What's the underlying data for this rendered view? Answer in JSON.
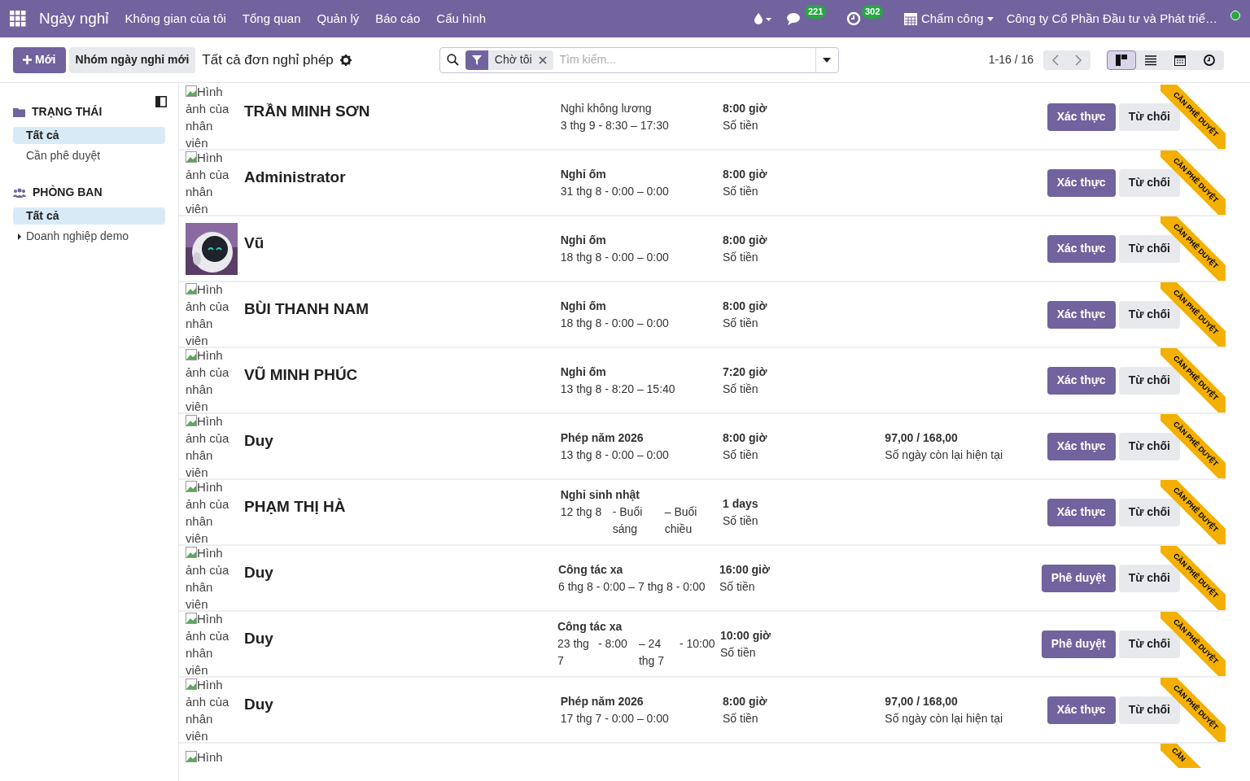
{
  "navbar": {
    "app_name": "Ngày nghỉ",
    "menu": [
      "Không gian của tôi",
      "Tổng quan",
      "Quản lý",
      "Báo cáo",
      "Cấu hình"
    ],
    "message_count": "221",
    "activity_count": "302",
    "attendance": "Chấm công",
    "company": "Công ty Cổ Phần Đầu tư và Phát triể…"
  },
  "control_panel": {
    "new_button": "Mới",
    "group_button": "Nhóm ngày nghỉ mới",
    "title": "Tất cả đơn nghỉ phép",
    "search": {
      "facet": "Chờ tôi",
      "placeholder": "Tìm kiếm..."
    },
    "pager": "1-16 / 16",
    "views": [
      {
        "kind": "kanban",
        "selected": true
      },
      {
        "kind": "list",
        "selected": false
      },
      {
        "kind": "calendar",
        "selected": false
      },
      {
        "kind": "activity",
        "selected": false
      }
    ]
  },
  "sidebar": {
    "sections": [
      {
        "kind": "status",
        "title": "TRẠNG THÁI",
        "items": [
          {
            "label": "Tất cả",
            "selected": true,
            "expandable": false
          },
          {
            "label": "Cần phê duyệt",
            "selected": false,
            "expandable": false
          }
        ]
      },
      {
        "kind": "department",
        "title": "PHÒNG BAN",
        "items": [
          {
            "label": "Tất cả",
            "selected": true,
            "expandable": false
          },
          {
            "label": "Doanh nghiệp demo",
            "selected": false,
            "expandable": true
          }
        ]
      }
    ]
  },
  "cards": [
    {
      "image": {
        "kind": "broken",
        "alt": "Hình ảnh của nhân viên"
      },
      "name": "TRẦN MINH SƠN",
      "leave_type": "Nghỉ không lương",
      "leave_type_bold": false,
      "dates": [
        "3 thg 9 - 8:30 – 17:30"
      ],
      "duration": "8:00 giờ",
      "duration_label": "Số tiền",
      "buttons": [
        "Xác thực",
        "Từ chối"
      ],
      "ribbon": "CẦN PHÊ DUYỆT"
    },
    {
      "image": {
        "kind": "broken",
        "alt": "Hình ảnh của nhân viên"
      },
      "name": "Administrator",
      "leave_type": "Nghỉ ốm",
      "leave_type_bold": true,
      "dates": [
        "31 thg 8 - 0:00 – 0:00"
      ],
      "duration": "8:00 giờ",
      "duration_label": "Số tiền",
      "buttons": [
        "Xác thực",
        "Từ chối"
      ],
      "ribbon": "CẦN PHÊ DUYỆT"
    },
    {
      "image": {
        "kind": "picture"
      },
      "name": "Vũ",
      "leave_type": "Nghỉ ốm",
      "leave_type_bold": true,
      "dates": [
        "18 thg 8 - 0:00 – 0:00"
      ],
      "duration": "8:00 giờ",
      "duration_label": "Số tiền",
      "buttons": [
        "Xác thực",
        "Từ chối"
      ],
      "ribbon": "CẦN PHÊ DUYỆT"
    },
    {
      "image": {
        "kind": "broken",
        "alt": "Hình ảnh của nhân viên"
      },
      "name": "BÙI THANH NAM",
      "leave_type": "Nghỉ ốm",
      "leave_type_bold": true,
      "dates": [
        "18 thg 8 - 0:00 – 0:00"
      ],
      "duration": "8:00 giờ",
      "duration_label": "Số tiền",
      "buttons": [
        "Xác thực",
        "Từ chối"
      ],
      "ribbon": "CẦN PHÊ DUYỆT"
    },
    {
      "image": {
        "kind": "broken",
        "alt": "Hình ảnh của nhân viên"
      },
      "name": "VŨ MINH PHÚC",
      "leave_type": "Nghỉ ốm",
      "leave_type_bold": true,
      "dates": [
        "13 thg 8 - 8:20 – 15:40"
      ],
      "duration": "7:20 giờ",
      "duration_label": "Số tiền",
      "buttons": [
        "Xác thực",
        "Từ chối"
      ],
      "ribbon": "CẦN PHÊ DUYỆT"
    },
    {
      "image": {
        "kind": "broken",
        "alt": "Hình ảnh của nhân viên"
      },
      "name": "Duy",
      "leave_type": "Phép năm 2026",
      "leave_type_bold": true,
      "dates": [
        "13 thg 8 - 0:00 – 0:00"
      ],
      "duration": "8:00 giờ",
      "duration_label": "Số tiền",
      "balance": "97,00 / 168,00",
      "balance_label": "Số ngày còn lại hiện tại",
      "buttons": [
        "Xác thực",
        "Từ chối"
      ],
      "ribbon": "CẦN PHÊ DUYỆT"
    },
    {
      "image": {
        "kind": "broken",
        "alt": "Hình ảnh của nhân viên"
      },
      "name": "PHẠM THỊ HÀ",
      "leave_type": "Nghỉ sinh nhật",
      "leave_type_bold": true,
      "dates": [
        "12 thg 8",
        "- Buổi sáng",
        "– Buổi chiều"
      ],
      "duration": "1 days",
      "duration_label": "Số tiền",
      "buttons": [
        "Xác thực",
        "Từ chối"
      ],
      "ribbon": "CẦN PHÊ DUYỆT"
    },
    {
      "image": {
        "kind": "broken",
        "alt": "Hình ảnh của nhân viên"
      },
      "name": "Duy",
      "leave_type": "Công tác xa",
      "leave_type_bold": true,
      "dates": [
        "6 thg 8 - 0:00 – 7 thg 8 - 0:00"
      ],
      "duration": "16:00 giờ",
      "duration_label": "Số tiền",
      "buttons": [
        "Phê duyệt",
        "Từ chối"
      ],
      "ribbon": "CẦN PHÊ DUYỆT"
    },
    {
      "image": {
        "kind": "broken",
        "alt": "Hình ảnh của nhân viên"
      },
      "name": "Duy",
      "leave_type": "Công tác xa",
      "leave_type_bold": true,
      "dates": [
        "23 thg 7",
        "- 8:00",
        "– 24 thg 7",
        "- 10:00"
      ],
      "duration": "10:00 giờ",
      "duration_label": "Số tiền",
      "buttons": [
        "Phê duyệt",
        "Từ chối"
      ],
      "ribbon": "CẦN PHÊ DUYỆT"
    },
    {
      "image": {
        "kind": "broken",
        "alt": "Hình ảnh của nhân viên"
      },
      "name": "Duy",
      "leave_type": "Phép năm 2026",
      "leave_type_bold": true,
      "dates": [
        "17 thg 7 - 0:00 – 0:00"
      ],
      "duration": "8:00 giờ",
      "duration_label": "Số tiền",
      "balance": "97,00 / 168,00",
      "balance_label": "Số ngày còn lại hiện tại",
      "buttons": [
        "Xác thực",
        "Từ chối"
      ],
      "ribbon": "CẦN PHÊ DUYỆT"
    }
  ],
  "partial_card": {
    "alt": "Hình",
    "ribbon": "CẦN"
  }
}
